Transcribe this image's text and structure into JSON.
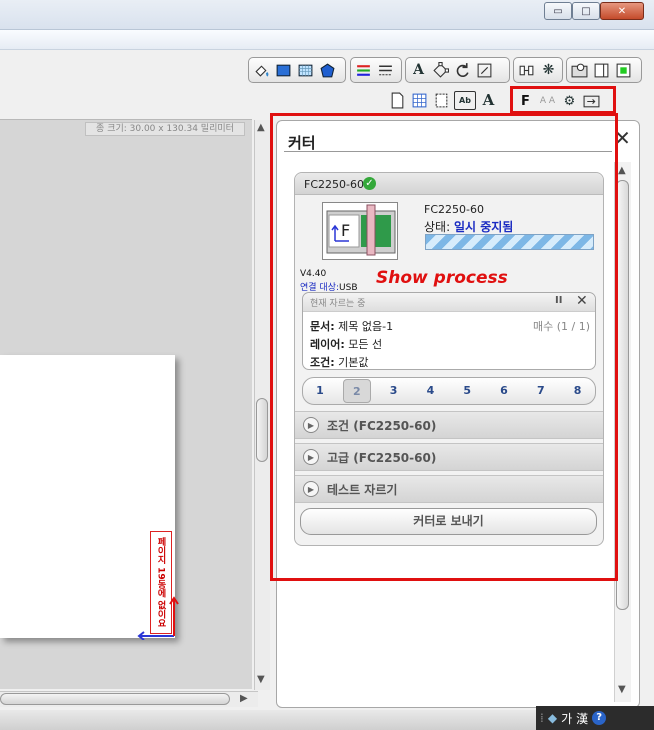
{
  "window": {
    "min": "▭",
    "max": "□",
    "close": "✕"
  },
  "canvas": {
    "size_label": "종 크기: 30.00 x 130.34 밀리미터",
    "paper_label": "페이지 19동에 없이요"
  },
  "panel": {
    "title": "커터",
    "close": "✕",
    "device": {
      "name": "FC2250-60",
      "model": "FC2250-60",
      "status_label": "상태:",
      "status_value": "일시 중지됨",
      "version": "V4.40",
      "connection_label": "연결 대상:",
      "connection_value": "USB",
      "icon_letter": "F",
      "progress": 1.0
    },
    "annotation": "Show process",
    "job": {
      "header": "현재 자르는 중",
      "pause": "II",
      "close": "✕",
      "document_label": "문서:",
      "document_value": "제목 없음-1",
      "layer_label": "레이어:",
      "layer_value": "모든 선",
      "condition_label": "조건:",
      "condition_value": "기본값",
      "copies": "매수 (1 / 1)"
    },
    "pages": [
      "1",
      "2",
      "3",
      "4",
      "5",
      "6",
      "7",
      "8"
    ],
    "selected_page": "2",
    "sections": [
      {
        "label": "조건 (FC2250-60)"
      },
      {
        "label": "고급 (FC2250-60)"
      },
      {
        "label": "테스트 자르기"
      }
    ],
    "send_button": "커터로 보내기"
  },
  "ime": {
    "lang": "가",
    "hanja": "漢",
    "help": "?"
  },
  "colors": {
    "highlight": "#e01010",
    "status_blue": "#1a2bc2",
    "check_green": "#34a83a"
  },
  "toolbar_icons": [
    "fill-icon",
    "rectangle-icon",
    "pattern-icon",
    "polygon-icon",
    "color-lines-icon",
    "line-style-icon",
    "text-icon",
    "node-icon",
    "rotate-icon",
    "transform-icon",
    "align-icon",
    "settings-gear-icon",
    "preview-icon",
    "window-icon",
    "color-swatch-icon",
    "page-icon",
    "grid-icon",
    "frame-icon",
    "text-fit-icon",
    "outline-text-icon",
    "cutter-tool-icon",
    "text-size-icon",
    "cutter-settings-icon",
    "send-icon"
  ]
}
